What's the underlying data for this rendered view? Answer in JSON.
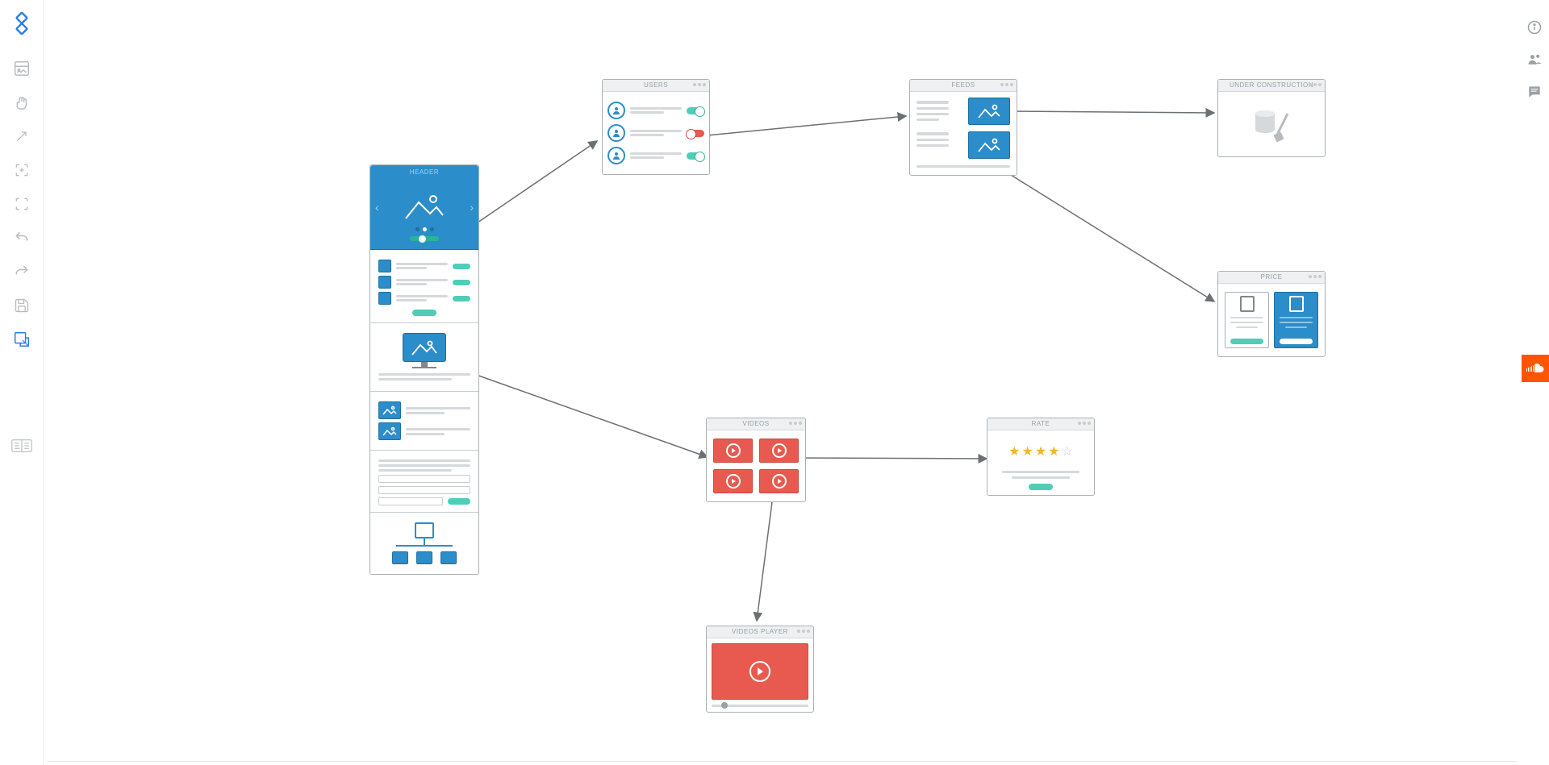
{
  "pages": {
    "header": {
      "title": "HEADER"
    },
    "users": {
      "title": "USERS"
    },
    "feeds": {
      "title": "FEEDS"
    },
    "construction": {
      "title": "UNDER CONSTRUCTION"
    },
    "price": {
      "title": "PRICE"
    },
    "videos": {
      "title": "VIDEOS"
    },
    "videos_player": {
      "title": "VIDEOS PLAYER"
    },
    "rate": {
      "title": "RATE",
      "stars_filled": 4,
      "stars_total": 5
    }
  },
  "connections": [
    {
      "from": "header-hero",
      "to": "users"
    },
    {
      "from": "users",
      "to": "feeds"
    },
    {
      "from": "feeds-thumb-1",
      "to": "construction"
    },
    {
      "from": "feeds-thumb-2",
      "to": "price"
    },
    {
      "from": "header-monitor",
      "to": "videos"
    },
    {
      "from": "videos-cell-1",
      "to": "rate"
    },
    {
      "from": "videos-cell-3",
      "to": "videos-player"
    }
  ]
}
